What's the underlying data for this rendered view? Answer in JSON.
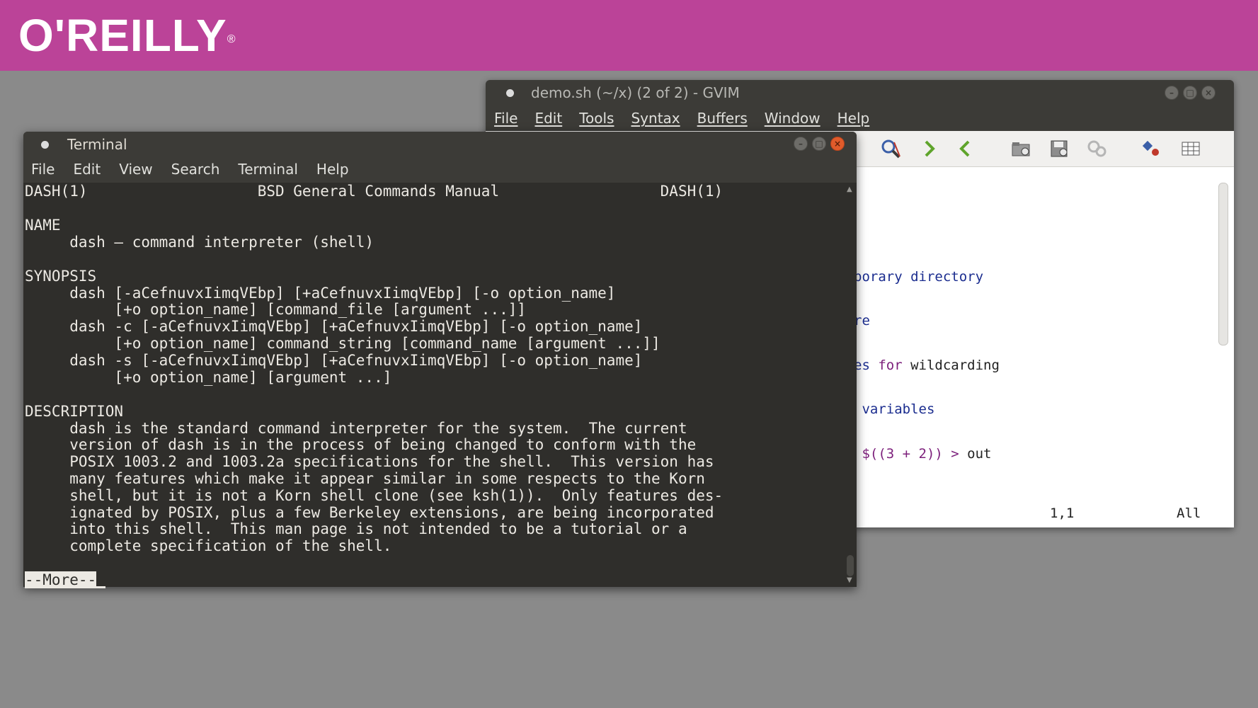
{
  "banner": {
    "logo": "O'REILLY",
    "registered": "®",
    "color": "#bb4398"
  },
  "gvim": {
    "title": "demo.sh (~/x) (2 of 2) - GVIM",
    "menu": [
      "File",
      "Edit",
      "Tools",
      "Syntax",
      "Buffers",
      "Window",
      "Help"
    ],
    "toolbar_icons": [
      "find-replace-icon",
      "forward-arrow-icon",
      "back-arrow-icon",
      "load-session-icon",
      "save-session-icon",
      "run-script-icon",
      "make-icon",
      "table-icon"
    ],
    "lines": [
      {
        "text": "porary directory"
      },
      {
        "text": "re"
      },
      {
        "pre": "es ",
        "kw": "for",
        "post": " wildcarding"
      },
      {
        "text": " variables"
      },
      {
        "pre": " $((3 + 2)) ",
        "kw": ">",
        "post": " out"
      }
    ],
    "status": {
      "position": "1,1",
      "scroll": "All"
    }
  },
  "terminal": {
    "title": "Terminal",
    "menu": [
      "File",
      "Edit",
      "View",
      "Search",
      "Terminal",
      "Help"
    ],
    "lines": [
      "DASH(1)                   BSD General Commands Manual                  DASH(1)",
      "",
      "NAME",
      "     dash — command interpreter (shell)",
      "",
      "SYNOPSIS",
      "     dash [-aCefnuvxIimqVEbp] [+aCefnuvxIimqVEbp] [-o option_name]",
      "          [+o option_name] [command_file [argument ...]]",
      "     dash -c [-aCefnuvxIimqVEbp] [+aCefnuvxIimqVEbp] [-o option_name]",
      "          [+o option_name] command_string [command_name [argument ...]]",
      "     dash -s [-aCefnuvxIimqVEbp] [+aCefnuvxIimqVEbp] [-o option_name]",
      "          [+o option_name] [argument ...]",
      "",
      "DESCRIPTION",
      "     dash is the standard command interpreter for the system.  The current",
      "     version of dash is in the process of being changed to conform with the",
      "     POSIX 1003.2 and 1003.2a specifications for the shell.  This version has",
      "     many features which make it appear similar in some respects to the Korn",
      "     shell, but it is not a Korn shell clone (see ksh(1)).  Only features des-",
      "     ignated by POSIX, plus a few Berkeley extensions, are being incorporated",
      "     into this shell.  This man page is not intended to be a tutorial or a",
      "     complete specification of the shell.",
      ""
    ],
    "pager_prompt": "--More--"
  }
}
